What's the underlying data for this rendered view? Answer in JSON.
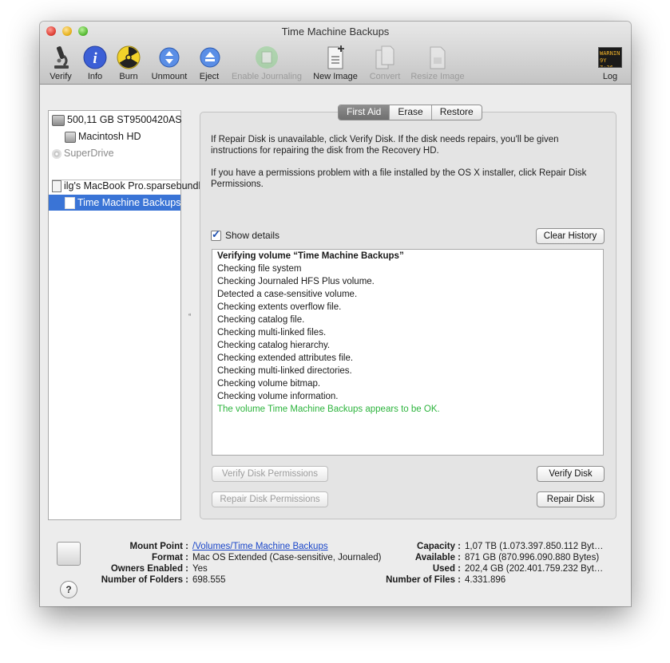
{
  "window": {
    "title": "Time Machine Backups"
  },
  "toolbar": {
    "verify": "Verify",
    "info": "Info",
    "burn": "Burn",
    "unmount": "Unmount",
    "eject": "Eject",
    "enable_journaling": "Enable Journaling",
    "new_image": "New Image",
    "convert": "Convert",
    "resize_image": "Resize Image",
    "log": "Log",
    "log_icon_text_1": "WARNIN",
    "log_icon_text_2": "9Y 7:36"
  },
  "sidebar": {
    "items": [
      {
        "label": "500,11 GB ST9500420AS"
      },
      {
        "label": "Macintosh HD"
      },
      {
        "label": "SuperDrive"
      },
      {
        "label": "ilg's MacBook Pro.sparsebundle"
      },
      {
        "label": "Time Machine Backups"
      }
    ]
  },
  "tabs": [
    "First Aid",
    "Erase",
    "Restore"
  ],
  "first_aid": {
    "paragraph_1": "If Repair Disk is unavailable, click Verify Disk. If the disk needs repairs, you'll be given instructions for repairing the disk from the Recovery HD.",
    "paragraph_2": "If you have a permissions problem with a file installed by the OS X installer, click Repair Disk Permissions.",
    "show_details": "Show details",
    "clear_history": "Clear History",
    "log_lines": [
      "Verifying volume “Time Machine Backups”",
      "Checking file system",
      "Checking Journaled HFS Plus volume.",
      "Detected a case-sensitive volume.",
      "Checking extents overflow file.",
      "Checking catalog file.",
      "Checking multi-linked files.",
      "Checking catalog hierarchy.",
      "Checking extended attributes file.",
      "Checking multi-linked directories.",
      "Checking volume bitmap.",
      "Checking volume information.",
      "The volume Time Machine Backups appears to be OK."
    ],
    "verify_permissions": "Verify Disk Permissions",
    "repair_permissions": "Repair Disk Permissions",
    "verify_disk": "Verify Disk",
    "repair_disk": "Repair Disk"
  },
  "footer": {
    "mount_point_label": "Mount Point :",
    "mount_point_value": "/Volumes/Time Machine Backups",
    "format_label": "Format :",
    "format_value": "Mac OS Extended (Case-sensitive, Journaled)",
    "owners_label": "Owners Enabled :",
    "owners_value": "Yes",
    "folders_label": "Number of Folders :",
    "folders_value": "698.555",
    "capacity_label": "Capacity :",
    "capacity_value": "1,07 TB (1.073.397.850.112 Byt…",
    "available_label": "Available :",
    "available_value": "871 GB (870.996.090.880 Bytes)",
    "used_label": "Used :",
    "used_value": "202,4 GB (202.401.759.232 Byt…",
    "files_label": "Number of Files :",
    "files_value": "4.331.896",
    "help": "?"
  },
  "colors": {
    "selection": "#3a74d6",
    "ok_text": "#2db43d",
    "link": "#1a46c9"
  }
}
